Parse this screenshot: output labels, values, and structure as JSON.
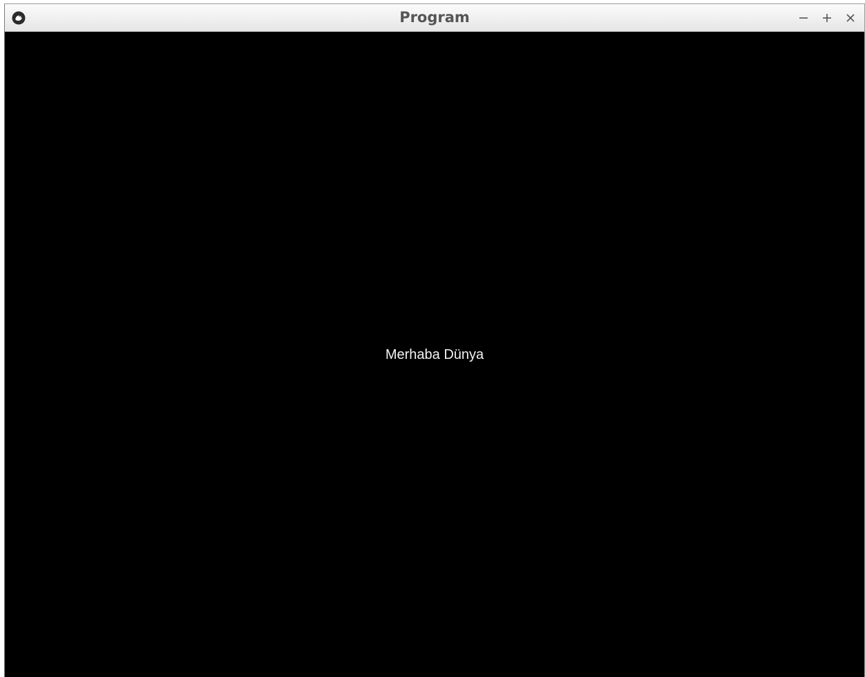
{
  "window": {
    "title": "Program",
    "icons": {
      "app": "kivy-logo-icon",
      "minimize": "minimize-icon",
      "maximize": "maximize-icon",
      "close": "close-icon"
    }
  },
  "content": {
    "label": "Merhaba Dünya"
  },
  "colors": {
    "background": "#000000",
    "text": "#f2f2f2",
    "titlebar": "#ececec",
    "title_text": "#555555"
  }
}
